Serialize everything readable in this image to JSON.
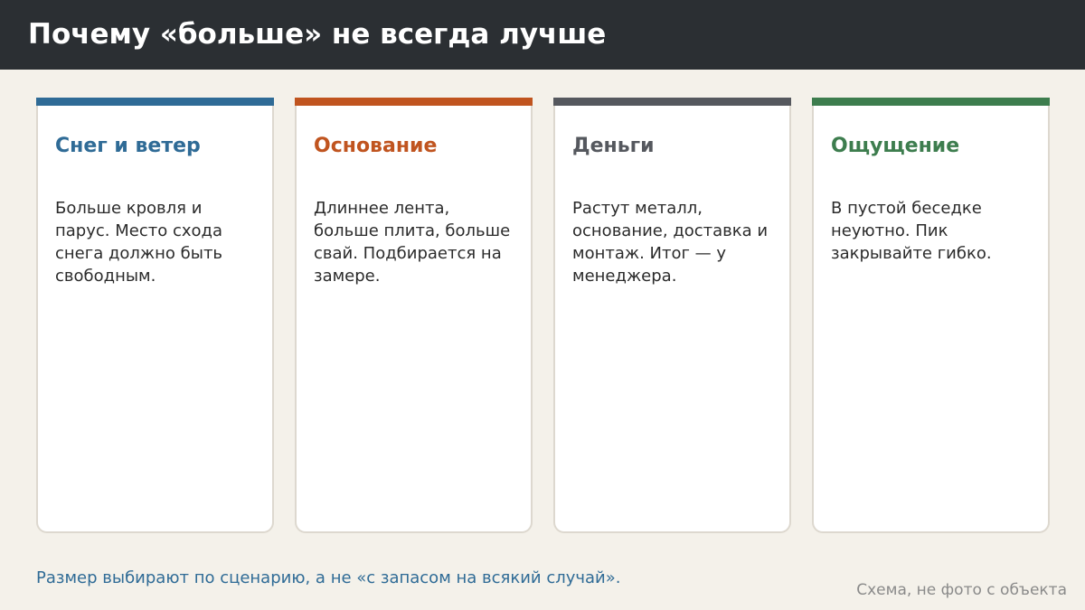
{
  "header": {
    "title": "Почему «больше» не всегда лучше"
  },
  "cards": [
    {
      "title": "Снег и ветер",
      "text": "Больше кровля и парус. Место схода снега должно быть свободным.",
      "color": "#2f6b96"
    },
    {
      "title": "Основание",
      "text": "Длиннее лента, больше плита, больше свай. Подбирается на замере.",
      "color": "#c0541f"
    },
    {
      "title": "Деньги",
      "text": "Растут металл, основание, доставка и монтаж. Итог — у менеджера.",
      "color": "#55585e"
    },
    {
      "title": "Ощущение",
      "text": "В пустой беседке неуютно. Пик закрывайте гибко.",
      "color": "#3d7d4e"
    }
  ],
  "footer": {
    "note": "Размер выбирают по сценарию, а не «с запасом на всякий случай».",
    "caption": "Схема, не фото с объекта"
  },
  "colors": {
    "header_background": "#2b2f33",
    "page_background": "#f4f1ea",
    "card_border": "#ddd8cf"
  }
}
